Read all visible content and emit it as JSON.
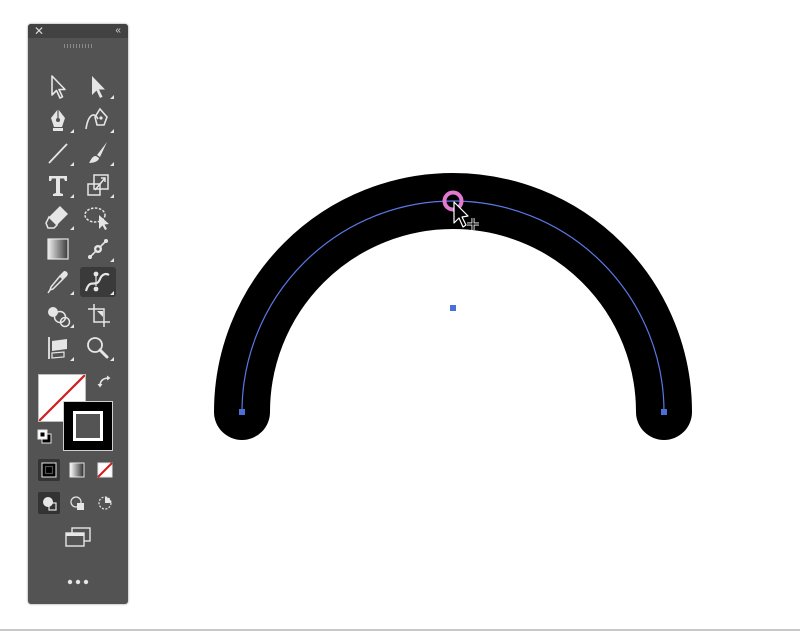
{
  "tools_panel": {
    "close_icon": "close-icon",
    "collapse_icon": "collapse-double-chevron-icon",
    "grip_icon": "panel-grip-icon",
    "tools": [
      {
        "name": "selection-tool-icon"
      },
      {
        "name": "direct-selection-tool-icon"
      },
      {
        "name": "pen-tool-icon"
      },
      {
        "name": "curvature-tool-icon"
      },
      {
        "name": "line-segment-tool-icon"
      },
      {
        "name": "paintbrush-tool-icon"
      },
      {
        "name": "type-tool-icon",
        "text": "T"
      },
      {
        "name": "scale-tool-icon"
      },
      {
        "name": "eraser-tool-icon"
      },
      {
        "name": "lasso-tool-icon"
      },
      {
        "name": "gradient-tool-icon"
      },
      {
        "name": "puppet-warp-tool-icon"
      },
      {
        "name": "eyedropper-tool-icon"
      },
      {
        "name": "width-tool-icon",
        "active": true
      },
      {
        "name": "shape-builder-tool-icon"
      },
      {
        "name": "artboard-tool-icon"
      },
      {
        "name": "free-transform-tool-icon"
      },
      {
        "name": "zoom-tool-icon"
      }
    ],
    "fill": {
      "color": "#ffffff",
      "state": "none"
    },
    "stroke": {
      "color": "#000000"
    },
    "draw_modes": [
      "draw-normal-icon",
      "draw-behind-icon",
      "draw-inside-icon"
    ],
    "color_modes": [
      "color-icon",
      "gradient-icon",
      "none-icon"
    ]
  },
  "canvas": {
    "stroke_color": "#000000",
    "path_color": "#5a78e6",
    "width_point_color": "#e27ad1",
    "center_point_color": "#4a6fd8"
  }
}
